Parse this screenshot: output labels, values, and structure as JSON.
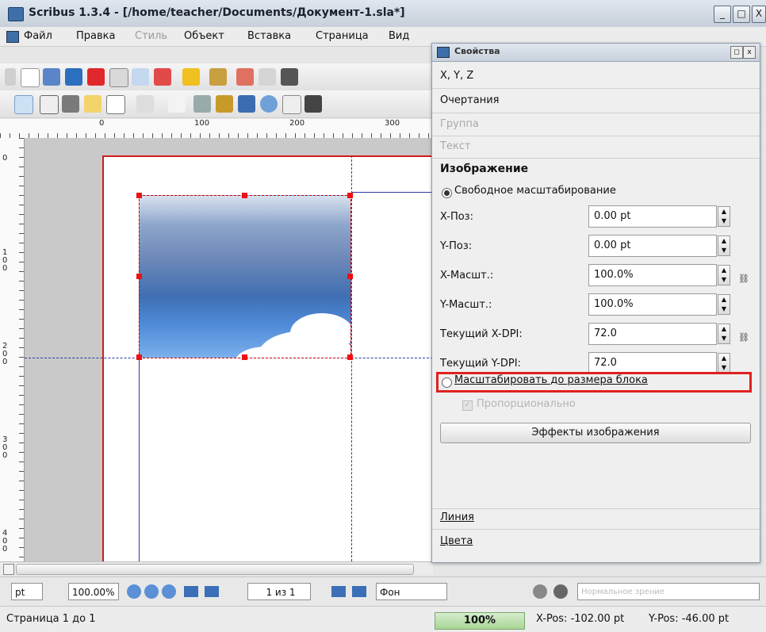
{
  "window": {
    "title": "Scribus 1.3.4 - [/home/teacher/Documents/Документ-1.sla*]",
    "buttons": [
      "_",
      "□",
      "X"
    ]
  },
  "menu": [
    "Файл",
    "Правка",
    "Стиль",
    "Объект",
    "Вставка",
    "Страница",
    "Вид"
  ],
  "ruler": {
    "ticks": [
      "0",
      "100",
      "200",
      "300"
    ],
    "vticks": [
      "0",
      "100",
      "200",
      "300",
      "400"
    ]
  },
  "panel": {
    "title": "Свойства",
    "sections_top": [
      "X, Y, Z",
      "Очертания",
      "Группа",
      "Текст",
      "Изображение"
    ],
    "free_scaling": "Свободное масштабирование",
    "fields": [
      {
        "label": "X-Поз:",
        "value": "0.00 pt"
      },
      {
        "label": "Y-Поз:",
        "value": "0.00 pt"
      },
      {
        "label": "X-Масшт.:",
        "value": "100.0%"
      },
      {
        "label": "Y-Масшт.:",
        "value": "100.0%"
      },
      {
        "label": "Текущий X-DPI:",
        "value": "72.0"
      },
      {
        "label": "Текущий Y-DPI:",
        "value": "72.0"
      }
    ],
    "fit_frame": "Масштабировать до размера блока",
    "proportional": "Пропорционально",
    "effects_button": "Эффекты изображения",
    "sections_bottom": [
      "Линия",
      "Цвета"
    ]
  },
  "bottombar": {
    "unit": "pt",
    "zoom": "100.00%",
    "page": "1 из 1",
    "layer": "Фон",
    "view_mode": "Нормальное зрение"
  },
  "status": {
    "page": "Страница 1 до 1",
    "zoom": "100%",
    "xpos": "X-Pos: -102.00 pt",
    "ypos": "Y-Pos: -46.00 pt"
  },
  "colors": {
    "highlight": "#e02020",
    "page_border": "#d01c1c",
    "guide": "#2c3aa0"
  }
}
